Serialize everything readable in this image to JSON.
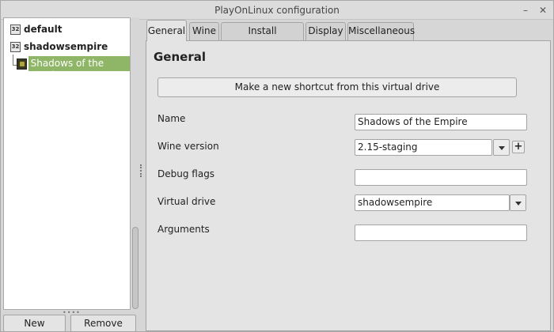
{
  "window": {
    "title": "PlayOnLinux configuration"
  },
  "titlebar": {
    "minimize_glyph": "–",
    "close_glyph": "✕"
  },
  "tree": {
    "items": [
      {
        "badge": "32",
        "label": "default"
      },
      {
        "badge": "32",
        "label": "shadowsempire"
      }
    ],
    "child": {
      "label": "Shadows of the Empire",
      "selected": true
    }
  },
  "bottom_buttons": {
    "new_label": "New",
    "remove_label": "Remove"
  },
  "tabs": [
    "General",
    "Wine",
    "Install components",
    "Display",
    "Miscellaneous"
  ],
  "general": {
    "heading": "General",
    "shortcut_button": "Make a new shortcut from this virtual drive",
    "name_label": "Name",
    "name_value": "Shadows of the Empire",
    "wine_version_label": "Wine version",
    "wine_version_value": "2.15-staging",
    "add_version_glyph": "+",
    "debug_flags_label": "Debug flags",
    "debug_flags_value": "",
    "virtual_drive_label": "Virtual drive",
    "virtual_drive_value": "shadowsempire",
    "arguments_label": "Arguments",
    "arguments_value": ""
  },
  "colors": {
    "selection": "#8eb666",
    "background": "#d6d6d6",
    "panel": "#e4e4e4"
  }
}
